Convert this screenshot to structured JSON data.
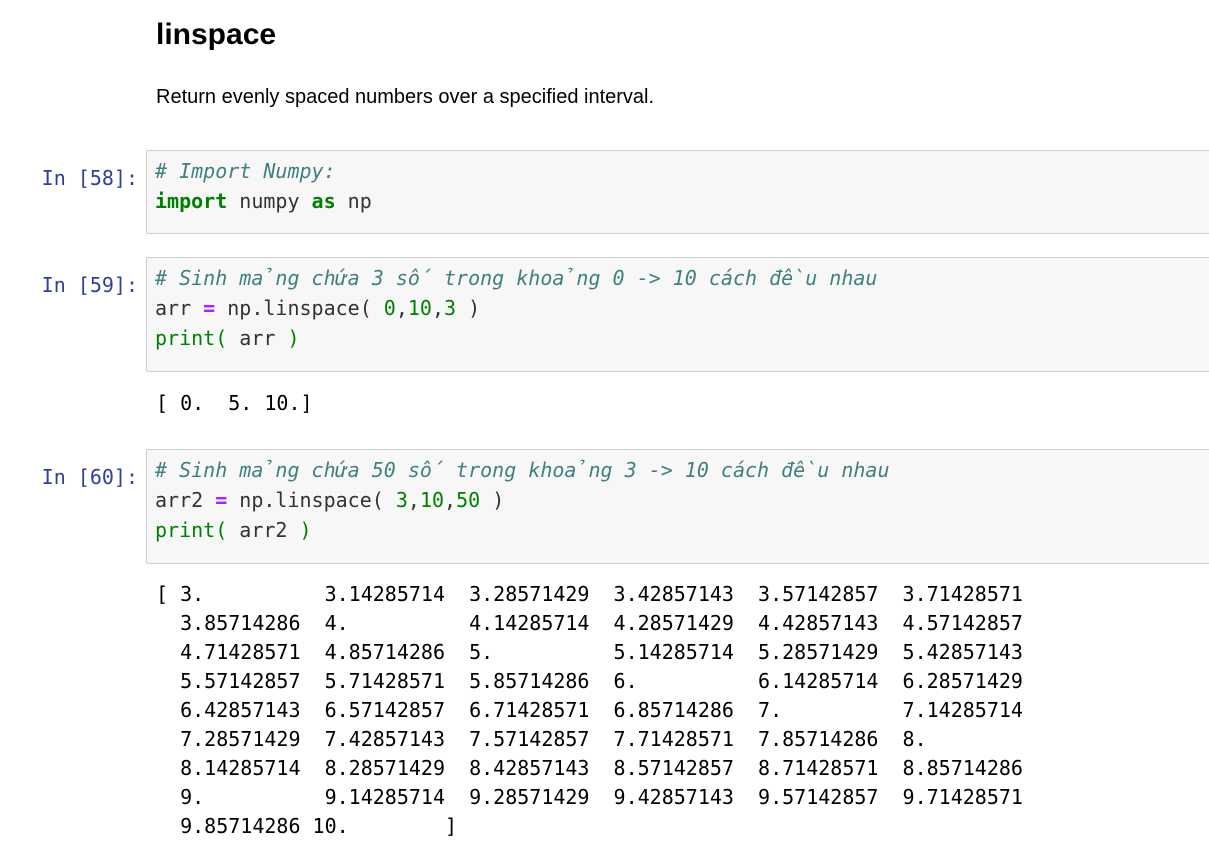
{
  "markdown": {
    "heading": "linspace",
    "paragraph": "Return evenly spaced numbers over a specified interval."
  },
  "cells": [
    {
      "prompt": "In [58]:",
      "comment": "# Import Numpy:",
      "kw_import": "import",
      "module": " numpy ",
      "kw_as": "as",
      "alias": " np"
    },
    {
      "prompt": "In [59]:",
      "comment": "# Sinh mảng chứa 3 số trong khoảng 0 -> 10 cách đều nhau",
      "var": "arr ",
      "eq": "=",
      "call": " np.linspace( ",
      "a1": "0",
      "a2": "10",
      "a3": "3",
      "close": " )",
      "print_kw": "print(",
      "print_arg": " arr ",
      "print_close": ")",
      "output": "[ 0.  5. 10.]"
    },
    {
      "prompt": "In [60]:",
      "comment": "# Sinh mảng chứa 50 số trong khoảng 3 -> 10 cách đều nhau",
      "var": "arr2 ",
      "eq": "=",
      "call": " np.linspace( ",
      "a1": "3",
      "a2": "10",
      "a3": "50",
      "close": " )",
      "print_kw": "print(",
      "print_arg": " arr2 ",
      "print_close": ")",
      "output_lines": [
        "[ 3.          3.14285714  3.28571429  3.42857143  3.57142857  3.71428571",
        "  3.85714286  4.          4.14285714  4.28571429  4.42857143  4.57142857",
        "  4.71428571  4.85714286  5.          5.14285714  5.28571429  5.42857143",
        "  5.57142857  5.71428571  5.85714286  6.          6.14285714  6.28571429",
        "  6.42857143  6.57142857  6.71428571  6.85714286  7.          7.14285714",
        "  7.28571429  7.42857143  7.57142857  7.71428571  7.85714286  8.",
        "  8.14285714  8.28571429  8.42857143  8.57142857  8.71428571  8.85714286",
        "  9.          9.14285714  9.28571429  9.42857143  9.57142857  9.71428571",
        "  9.85714286 10.        ]"
      ]
    }
  ],
  "colors": {
    "prompt": "#303f9f",
    "comment": "#408080",
    "keyword": "#008000",
    "operator": "#aa22ff",
    "cell_bg": "#f7f7f7",
    "cell_border": "#cfcfcf"
  }
}
